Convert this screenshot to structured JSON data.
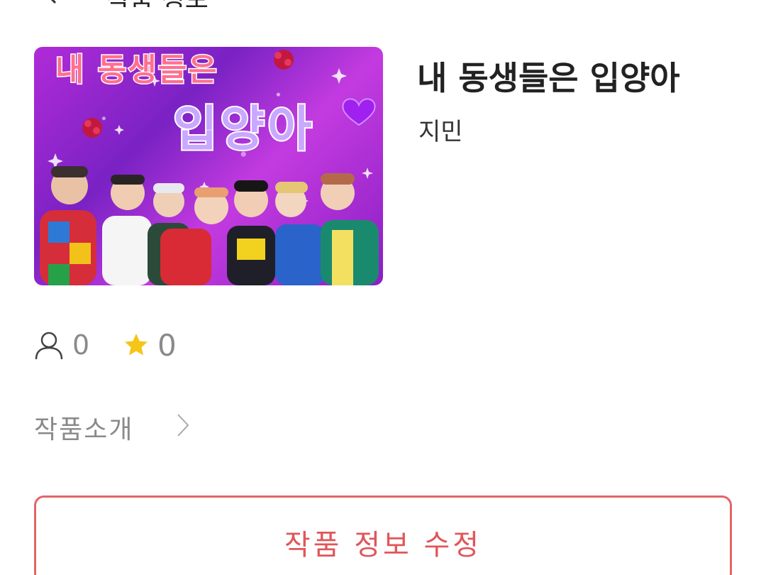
{
  "header": {
    "back_icon": "chevron-left-icon",
    "title_fragment": "작품 정보"
  },
  "work": {
    "title": "내 동생들은 입양아",
    "author": "지민",
    "cover": {
      "top_text": "내 동생들은",
      "main_text": "입양아"
    }
  },
  "stats": {
    "readers_icon": "person-icon",
    "readers": "0",
    "stars_icon": "star-icon",
    "stars": "0"
  },
  "intro": {
    "label": "작품소개",
    "icon": "chevron-right-icon"
  },
  "actions": {
    "edit_label": "작품 정보 수정"
  },
  "colors": {
    "accent": "#e46466",
    "star": "#f5c518",
    "muted_text": "#8a8a8a",
    "title_text": "#222222"
  }
}
